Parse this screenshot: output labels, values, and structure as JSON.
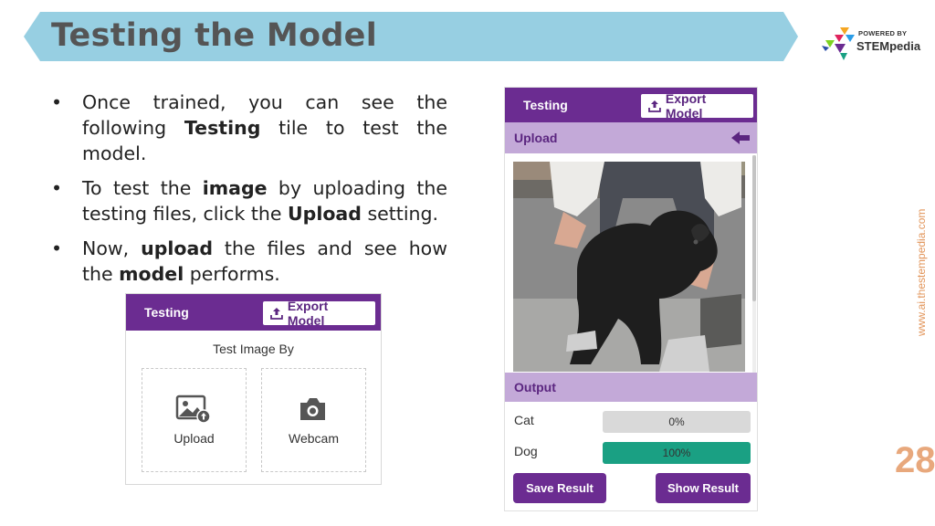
{
  "slide": {
    "title": "Testing the Model",
    "page_number": "28",
    "website": "www.ai.thestempedia.com"
  },
  "logo": {
    "tagline": "POWERED BY",
    "name": "STEMpedia"
  },
  "bullets": [
    {
      "parts": [
        "Once trained, you can see the following ",
        "Testing",
        " tile to test the model."
      ]
    },
    {
      "parts": [
        "To test the ",
        "image",
        " by uploading the testing files, click the ",
        "Upload",
        " setting."
      ]
    },
    {
      "parts": [
        "Now, ",
        "upload",
        " the files and see how the ",
        "model",
        " performs."
      ]
    }
  ],
  "panel_select": {
    "title": "Testing",
    "export_label": "Export Model",
    "prompt": "Test Image By",
    "options": [
      {
        "label": "Upload",
        "icon": "image-upload-icon"
      },
      {
        "label": "Webcam",
        "icon": "camera-icon"
      }
    ]
  },
  "panel_result": {
    "title": "Testing",
    "export_label": "Export Model",
    "upload_label": "Upload",
    "output_label": "Output",
    "image_icon": "dog-photo",
    "results": [
      {
        "label": "Cat",
        "value_text": "0%",
        "fraction": 0.0,
        "color": "#d9d9d9"
      },
      {
        "label": "Dog",
        "value_text": "100%",
        "fraction": 1.0,
        "color": "#1aa083"
      }
    ],
    "save_label": "Save Result",
    "show_label": "Show Result"
  },
  "colors": {
    "title_bar": "#97cfe2",
    "accent_purple": "#6b2c91",
    "sub_header": "#c3a9d8",
    "success_green": "#1aa083",
    "page_number": "#e8a87c"
  }
}
